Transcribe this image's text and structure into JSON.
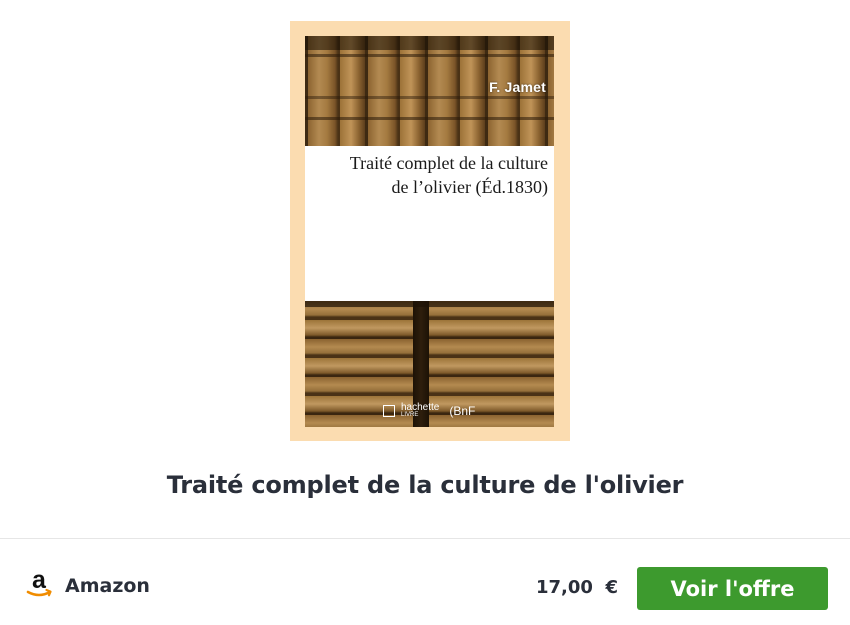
{
  "cover": {
    "author": "F. Jamet",
    "title_line1": "Traité complet de la culture",
    "title_line2": "de l’olivier (Éd.1830)",
    "publisher_hachette": "hachette",
    "publisher_livre": "LIVRE",
    "publisher_bnf": "(BnF"
  },
  "product": {
    "title": "Traité complet de la culture de l'olivier"
  },
  "offer": {
    "seller_icon": "amazon-logo-icon",
    "seller_name": "Amazon",
    "price": "17,00  €",
    "button_label": "Voir l'offre",
    "button_color": "#3d9a2e"
  }
}
